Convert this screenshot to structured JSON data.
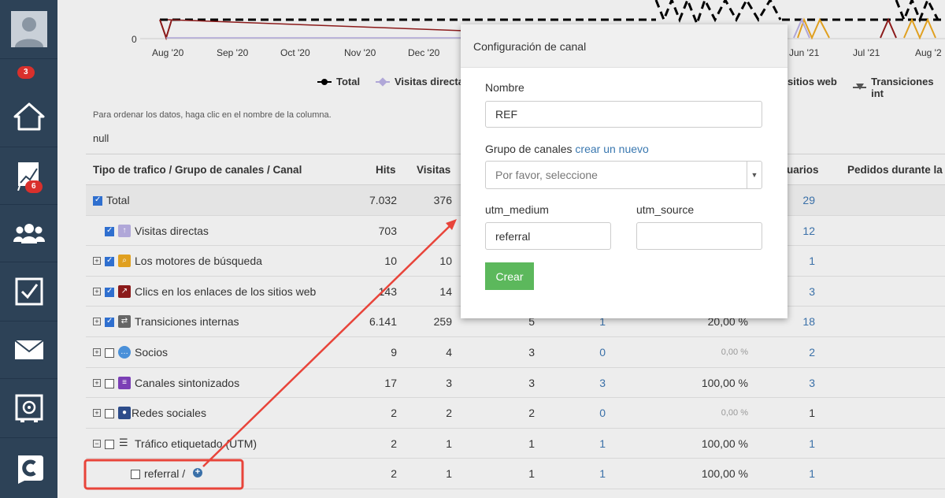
{
  "sidebar": {
    "badges": {
      "home_top": "3",
      "reports": "6"
    },
    "items": [
      {
        "icon": "avatar-icon"
      },
      {
        "icon": "home-icon"
      },
      {
        "icon": "chart-icon"
      },
      {
        "icon": "users-icon"
      },
      {
        "icon": "checkbox-icon"
      },
      {
        "icon": "mail-icon"
      },
      {
        "icon": "settings-icon"
      },
      {
        "icon": "logo-icon"
      }
    ]
  },
  "chart": {
    "y_tick": "0",
    "x_ticks": [
      "Aug '20",
      "Sep '20",
      "Oct '20",
      "Nov '20",
      "Dec '20",
      "Jun '21",
      "Jul '21",
      "Aug '2"
    ],
    "legend": [
      "Total",
      "Visitas directa",
      "sitios web",
      "Transiciones int"
    ]
  },
  "hint": "Para ordenar los datos, haga clic en el nombre de la columna.",
  "null_text": "null",
  "table": {
    "headers": {
      "type": "Tipo de trafico / Grupo de canales / Canal",
      "hits": "Hits",
      "visits": "Visitas",
      "users": "uarios",
      "orders": "Pedidos durante la"
    },
    "rows": [
      {
        "name": "Total",
        "hits": "7.032",
        "visits": "376",
        "c3": "",
        "c4": "",
        "pct": "",
        "users": "29"
      },
      {
        "name": "Visitas directas",
        "hits": "703",
        "visits": "",
        "c3": "",
        "c4": "",
        "pct": "",
        "users": "12"
      },
      {
        "name": "Los motores de búsqueda",
        "hits": "10",
        "visits": "10",
        "c3": "",
        "c4": "",
        "pct": "",
        "users": "1"
      },
      {
        "name": "Clics en los enlaces de los sitios web",
        "hits": "143",
        "visits": "14",
        "c3": "",
        "c4": "",
        "pct": "",
        "users": "3"
      },
      {
        "name": "Transiciones internas",
        "hits": "6.141",
        "visits": "259",
        "c3": "5",
        "c4": "1",
        "pct": "20,00 %",
        "users": "18"
      },
      {
        "name": "Socios",
        "hits": "9",
        "visits": "4",
        "c3": "3",
        "c4": "0",
        "pct": "0,00 %",
        "users": "2"
      },
      {
        "name": "Canales sintonizados",
        "hits": "17",
        "visits": "3",
        "c3": "3",
        "c4": "3",
        "pct": "100,00 %",
        "users": "3"
      },
      {
        "name": "Redes sociales",
        "hits": "2",
        "visits": "2",
        "c3": "2",
        "c4": "0",
        "pct": "0,00 %",
        "users": "1"
      },
      {
        "name": "Tráfico etiquetado (UTM)",
        "hits": "2",
        "visits": "1",
        "c3": "1",
        "c4": "1",
        "pct": "100,00 %",
        "users": "1"
      },
      {
        "name": "referral /",
        "hits": "2",
        "visits": "1",
        "c3": "1",
        "c4": "1",
        "pct": "100,00 %",
        "users": "1"
      }
    ]
  },
  "modal": {
    "title": "Configuración de canal",
    "name_label": "Nombre",
    "name_value": "REF",
    "group_label": "Grupo de canales",
    "group_link": "crear un nuevo",
    "group_placeholder": "Por favor, seleccione",
    "utm_medium_label": "utm_medium",
    "utm_medium_value": "referral",
    "utm_source_label": "utm_source",
    "utm_source_value": "",
    "create_button": "Crear"
  },
  "colors": {
    "sidebar": "#2d4257",
    "badge": "#d9302c",
    "link": "#3a70a8",
    "create_button": "#5cb85c",
    "annotation": "#e8443a"
  }
}
